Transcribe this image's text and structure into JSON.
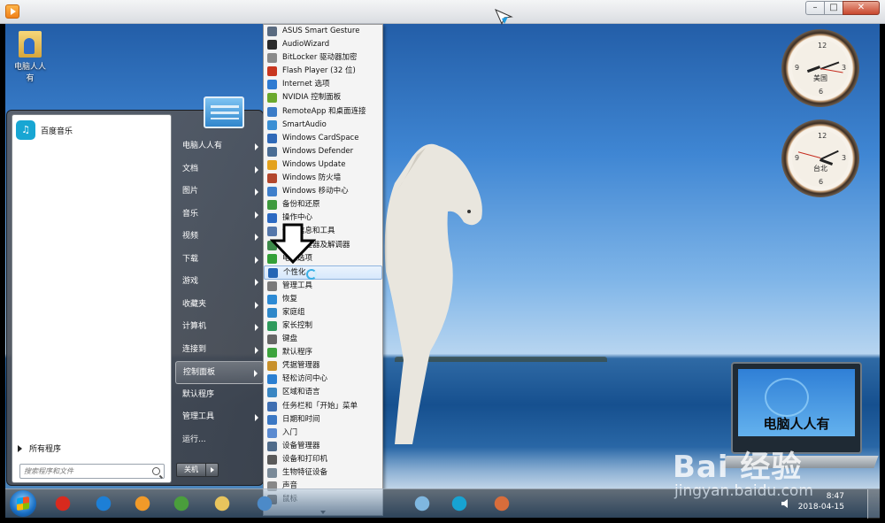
{
  "desktop": {
    "icon_label": "电脑人人有",
    "clocks": [
      {
        "label": "美国"
      },
      {
        "label": "台北"
      }
    ],
    "laptop_text": "电脑人人有"
  },
  "start_menu": {
    "pinned": [
      {
        "label": "百度音乐",
        "icon": "music-icon"
      }
    ],
    "all_programs": "所有程序",
    "search_placeholder": "搜索程序和文件",
    "right_items": [
      "电脑人人有",
      "文档",
      "图片",
      "音乐",
      "视频",
      "下载",
      "游戏",
      "收藏夹",
      "计算机",
      "连接到",
      "控制面板",
      "默认程序",
      "管理工具",
      "运行..."
    ],
    "right_items_with_arrow": [
      0,
      1,
      2,
      3,
      4,
      5,
      6,
      7,
      8,
      9,
      10,
      12
    ],
    "active_index": 10,
    "shutdown_label": "关机"
  },
  "control_panel": {
    "items": [
      "ASUS Smart Gesture",
      "AudioWizard",
      "BitLocker 驱动器加密",
      "Flash Player (32 位)",
      "Internet 选项",
      "NVIDIA 控制面板",
      "RemoteApp 和桌面连接",
      "SmartAudio",
      "Windows CardSpace",
      "Windows Defender",
      "Windows Update",
      "Windows 防火墙",
      "Windows 移动中心",
      "备份和还原",
      "操作中心",
      "性能信息和工具",
      "设备管理器及解调器",
      "电源选项",
      "个性化",
      "管理工具",
      "恢复",
      "家庭组",
      "家长控制",
      "键盘",
      "默认程序",
      "凭据管理器",
      "轻松访问中心",
      "区域和语言",
      "任务栏和「开始」菜单",
      "日期和时间",
      "入门",
      "设备管理器",
      "设备和打印机",
      "生物特征设备",
      "声音",
      "鼠标"
    ],
    "highlighted_index": 18,
    "icon_colors": [
      "#5a6b80",
      "#2a2a2a",
      "#8a8a8a",
      "#c8361f",
      "#2f7bd2",
      "#6aa82c",
      "#3b7cc7",
      "#3a8fd4",
      "#2f69b8",
      "#4a6d94",
      "#e4a21d",
      "#b3472d",
      "#3f7fcb",
      "#3e9a3e",
      "#2c69c2",
      "#5577aa",
      "#3d8a4a",
      "#34a038",
      "#2566b5",
      "#7a7a7a",
      "#2c8ad4",
      "#2f88c9",
      "#2e9a5c",
      "#666666",
      "#3da33d",
      "#c8902a",
      "#2b7fd1",
      "#3a86c2",
      "#3f6fb2",
      "#3b78c4",
      "#5a8ad0",
      "#4f6b8a",
      "#5a5a5a",
      "#7a8a98",
      "#888888",
      "#444444"
    ]
  },
  "taskbar": {
    "time": "8:47",
    "date": "2018-04-15",
    "apps": [
      {
        "name": "game-icon",
        "color": "#d82a1e"
      },
      {
        "name": "ie-icon",
        "color": "#1d7fd6"
      },
      {
        "name": "media-player-icon",
        "color": "#f19a29"
      },
      {
        "name": "chrome-icon",
        "color": "#4a9e3c"
      },
      {
        "name": "explorer-icon",
        "color": "#e8c45d"
      },
      {
        "name": "control-panel-icon",
        "color": "#4c8ac8"
      },
      {
        "name": "fan-icon",
        "color": "#7fb7e0"
      },
      {
        "name": "baidu-music-icon",
        "color": "#17a3d2"
      },
      {
        "name": "paint-icon",
        "color": "#d86d3b"
      }
    ]
  },
  "watermark": {
    "logo": "Bai 经验",
    "url": "jingyan.baidu.com"
  }
}
